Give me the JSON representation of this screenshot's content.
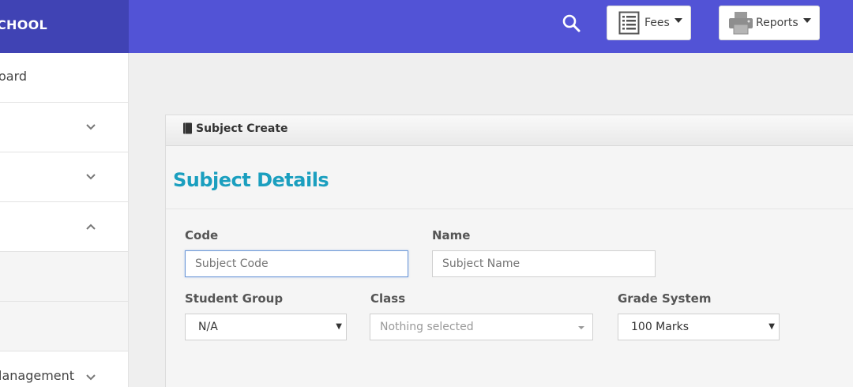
{
  "brand": {
    "text": "CHOOL"
  },
  "header": {
    "search_icon": "search-icon",
    "fees": {
      "label": "Fees",
      "icon": "list-document-icon"
    },
    "reports": {
      "label": "Reports",
      "icon": "printer-icon"
    }
  },
  "sidebar": {
    "items": [
      {
        "label": "oard"
      },
      {
        "label": "",
        "chevron": "down"
      },
      {
        "label": "",
        "chevron": "down"
      },
      {
        "label": "",
        "chevron": "up"
      },
      {
        "label": ""
      },
      {
        "label": ""
      },
      {
        "label": "lanagement",
        "chevron": "down"
      }
    ]
  },
  "panel": {
    "title": "Subject Create",
    "section_title": "Subject Details",
    "fields": {
      "code": {
        "label": "Code",
        "placeholder": "Subject Code",
        "value": ""
      },
      "name": {
        "label": "Name",
        "placeholder": "Subject Name",
        "value": ""
      },
      "student_group": {
        "label": "Student Group",
        "value": "N/A"
      },
      "class": {
        "label": "Class",
        "value": "Nothing selected"
      },
      "grade_system": {
        "label": "Grade System",
        "value": "100 Marks"
      }
    }
  },
  "colors": {
    "topbar": "#5253d6",
    "brand_bg": "#4043b4",
    "accent": "#1b9fbf"
  }
}
